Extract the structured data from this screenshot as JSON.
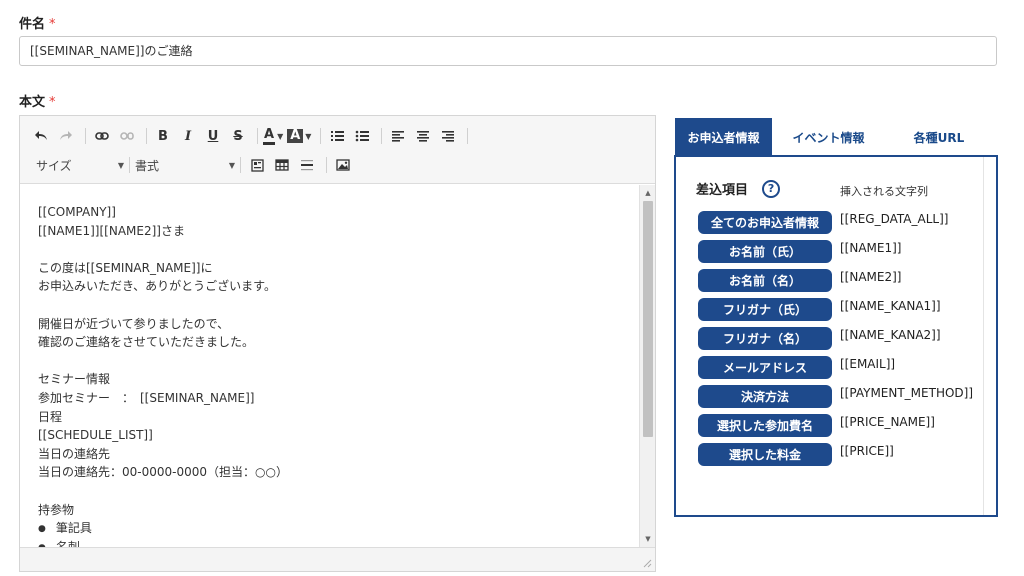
{
  "subject": {
    "label": "件名",
    "required_mark": "*",
    "value": "[[SEMINAR_NAME]]のご連絡"
  },
  "body": {
    "label": "本文",
    "required_mark": "*",
    "toolbar": {
      "size_label": "サイズ",
      "format_label": "書式"
    },
    "lines": [
      "[[COMPANY]]",
      "[[NAME1]][[NAME2]]さま",
      "",
      "この度は[[SEMINAR_NAME]]に",
      "お申込みいただき、ありがとうございます。",
      "",
      "開催日が近づいて参りましたので、",
      "確認のご連絡をさせていただきました。",
      "",
      "セミナー情報",
      "参加セミナー　：　[[SEMINAR_NAME]]",
      "日程",
      "[[SCHEDULE_LIST]]",
      "当日の連絡先",
      "当日の連絡先：00-0000-0000（担当：○○）",
      "",
      "持参物",
      "筆記具",
      "名刺"
    ]
  },
  "tabs": [
    {
      "label": "お申込者情報",
      "active": true
    },
    {
      "label": "イベント情報",
      "active": false
    },
    {
      "label": "各種URL",
      "active": false
    }
  ],
  "panel": {
    "title": "差込項目",
    "help": "?",
    "subtitle": "挿入される文字列",
    "items": [
      {
        "label": "全てのお申込者情報",
        "value": "[[REG_DATA_ALL]]"
      },
      {
        "label": "お名前（氏）",
        "value": "[[NAME1]]"
      },
      {
        "label": "お名前（名）",
        "value": "[[NAME2]]"
      },
      {
        "label": "フリガナ（氏）",
        "value": "[[NAME_KANA1]]"
      },
      {
        "label": "フリガナ（名）",
        "value": "[[NAME_KANA2]]"
      },
      {
        "label": "メールアドレス",
        "value": "[[EMAIL]]"
      },
      {
        "label": "決済方法",
        "value": "[[PAYMENT_METHOD]]"
      },
      {
        "label": "選択した参加費名",
        "value": "[[PRICE_NAME]]"
      },
      {
        "label": "選択した料金",
        "value": "[[PRICE]]"
      }
    ]
  },
  "colors": {
    "accent": "#1e4a8c",
    "required": "#e53935"
  }
}
